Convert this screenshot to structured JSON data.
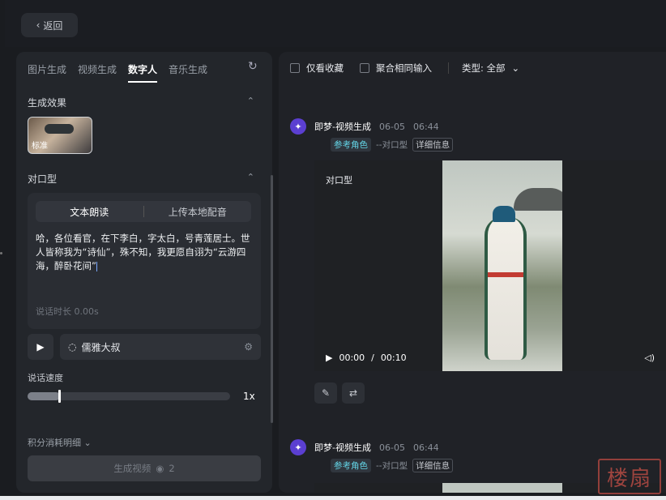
{
  "header": {
    "back_label": "返回"
  },
  "left_panel": {
    "tabs": [
      "图片生成",
      "视频生成",
      "数字人",
      "音乐生成"
    ],
    "active_tab": "数字人",
    "effect_section_title": "生成效果",
    "effect_card_label": "标准",
    "lip_sync_title": "对口型",
    "modes": [
      "文本朗读",
      "上传本地配音"
    ],
    "script_text": "哈，各位看官，在下李白，字太白，号青莲居士。世人皆称我为“诗仙”，殊不知，我更愿自诩为“云游四海，醉卧花间”",
    "duration_text": "说话时长 0.00s",
    "voice_name": "儒雅大叔",
    "speed_label": "说话速度",
    "speed_value": "1x",
    "speed_fraction": 0.16,
    "points_label": "积分消耗明细",
    "generate_label": "生成视频",
    "generate_cost": "2"
  },
  "right_panel": {
    "filters": {
      "favorites": "仅看收藏",
      "merge_same": "聚合相同输入",
      "type_label": "类型: 全部"
    },
    "entries": [
      {
        "name": "即梦-视频生成",
        "date": "06-05",
        "time": "06:44",
        "tag_ref": "参考角色",
        "tag_sub": "--对口型",
        "tag_detail": "详细信息",
        "video_title": "对口型",
        "current_time": "00:00",
        "sep": "/",
        "duration": "00:10"
      },
      {
        "name": "即梦-视频生成",
        "date": "06-05",
        "time": "06:44",
        "tag_ref": "参考角色",
        "tag_sub": "--对口型",
        "tag_detail": "详细信息"
      }
    ]
  },
  "watermark_text": "楼扇"
}
